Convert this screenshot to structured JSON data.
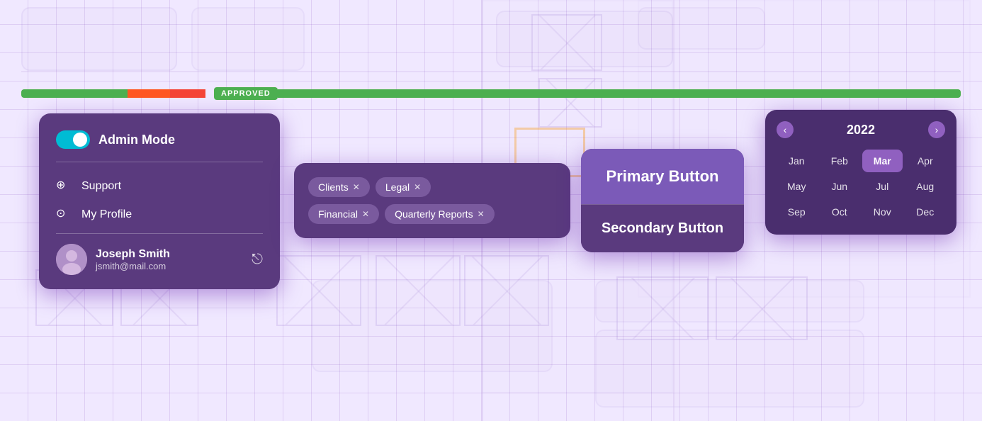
{
  "background": {
    "grid_color": "rgba(120,60,180,0.15)"
  },
  "status_bar": {
    "badge_text": "APPROVED"
  },
  "card_profile": {
    "admin_mode_label": "Admin Mode",
    "menu_items": [
      {
        "id": "support",
        "label": "Support",
        "icon": "⊕"
      },
      {
        "id": "my-profile",
        "label": "My Profile",
        "icon": "⊙"
      }
    ],
    "user": {
      "name": "Joseph Smith",
      "email": "jsmith@mail.com",
      "avatar_emoji": "👤"
    },
    "logout_icon": "⎋"
  },
  "card_tabs": {
    "tabs": [
      {
        "id": "clients",
        "label": "Clients"
      },
      {
        "id": "legal",
        "label": "Legal"
      },
      {
        "id": "financial",
        "label": "Financial"
      },
      {
        "id": "quarterly-reports",
        "label": "Quarterly Reports"
      }
    ]
  },
  "card_buttons": {
    "primary_label": "Primary Button",
    "secondary_label": "Secondary Button"
  },
  "card_calendar": {
    "year": "2022",
    "months": [
      "Jan",
      "Feb",
      "Mar",
      "Apr",
      "May",
      "Jun",
      "Jul",
      "Aug",
      "Sep",
      "Oct",
      "Nov",
      "Dec"
    ],
    "active_month": "Mar",
    "prev_icon": "‹",
    "next_icon": "›"
  }
}
